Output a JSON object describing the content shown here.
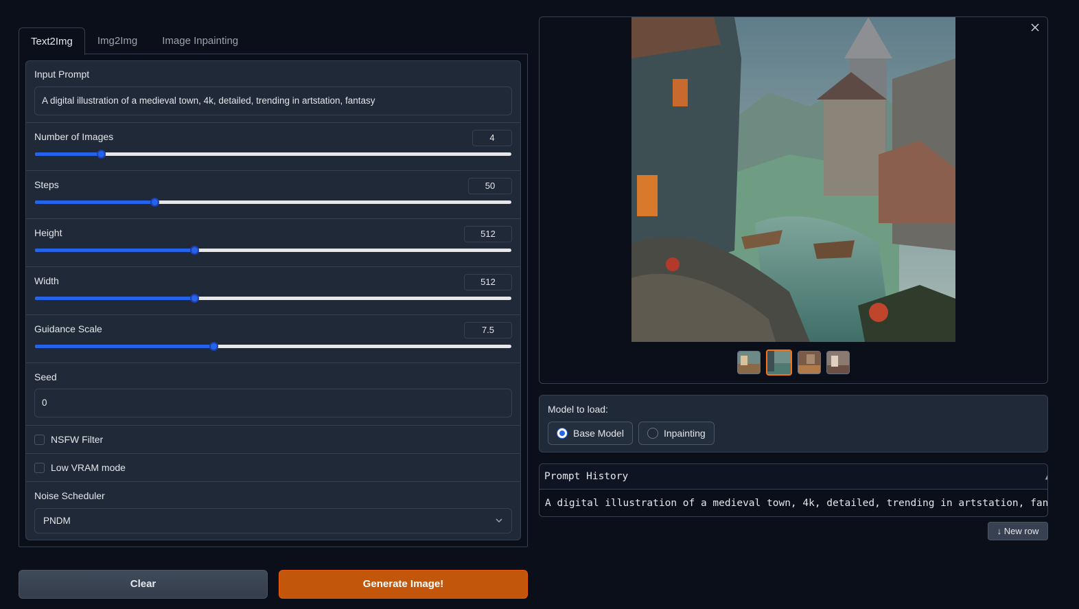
{
  "tabs": [
    {
      "label": "Text2Img",
      "active": true
    },
    {
      "label": "Img2Img",
      "active": false
    },
    {
      "label": "Image Inpainting",
      "active": false
    }
  ],
  "prompt": {
    "label": "Input Prompt",
    "value": "A digital illustration of a medieval town, 4k, detailed, trending in artstation, fantasy"
  },
  "sliders": {
    "num_images": {
      "label": "Number of Images",
      "value": "4",
      "fraction": 0.138
    },
    "steps": {
      "label": "Steps",
      "value": "50",
      "fraction": 0.25
    },
    "height": {
      "label": "Height",
      "value": "512",
      "fraction": 0.335
    },
    "width": {
      "label": "Width",
      "value": "512",
      "fraction": 0.335
    },
    "guidance": {
      "label": "Guidance Scale",
      "value": "7.5",
      "fraction": 0.375
    }
  },
  "seed": {
    "label": "Seed",
    "value": "0"
  },
  "checks": {
    "nsfw": {
      "label": "NSFW Filter",
      "checked": false
    },
    "low_vram": {
      "label": "Low VRAM mode",
      "checked": false
    }
  },
  "scheduler": {
    "label": "Noise Scheduler",
    "value": "PNDM"
  },
  "buttons": {
    "clear": "Clear",
    "generate": "Generate Image!"
  },
  "gallery": {
    "close_icon": "close-icon",
    "thumbnail_count": 4,
    "selected_index": 1
  },
  "model": {
    "label": "Model to load:",
    "options": [
      {
        "label": "Base Model",
        "selected": true
      },
      {
        "label": "Inpainting",
        "selected": false
      }
    ]
  },
  "history": {
    "header": "Prompt History",
    "rows": [
      "A digital illustration of a medieval town, 4k, detailed, trending in artstation, fantasy"
    ],
    "new_row": "New row"
  },
  "colors": {
    "accent": "#2563eb",
    "generate": "#c2570c",
    "selected_thumb": "#f97316"
  }
}
